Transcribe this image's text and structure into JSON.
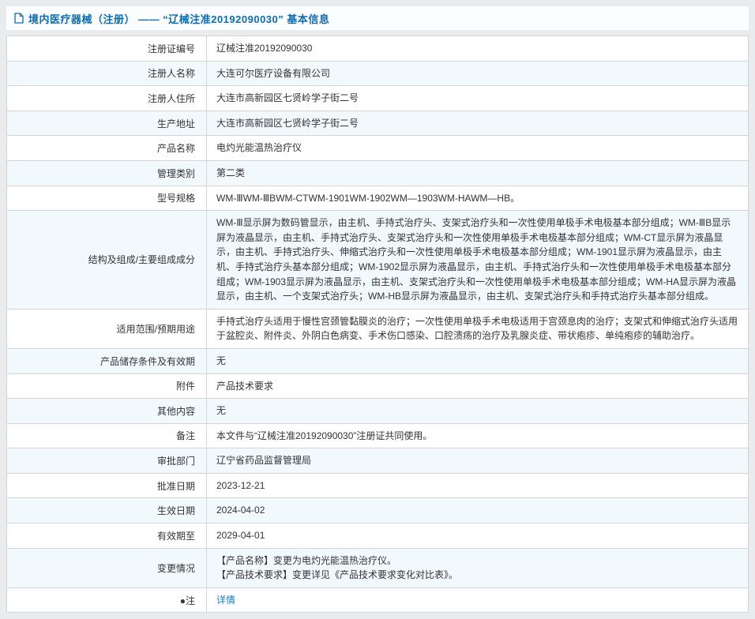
{
  "header": {
    "title": "境内医疗器械（注册） —— “辽械注准20192090030” 基本信息",
    "icon": "document-icon",
    "accent_color": "#0b6cb4"
  },
  "colors": {
    "page_background": "#e9ebed",
    "row_alt": "#f2f9fd",
    "border": "#d4d4d4",
    "link": "#1a7dc5"
  },
  "table": {
    "rows": [
      {
        "label": "注册证编号",
        "value": "辽械注准20192090030"
      },
      {
        "label": "注册人名称",
        "value": "大连可尔医疗设备有限公司"
      },
      {
        "label": "注册人住所",
        "value": "大连市高新园区七贤岭学子街二号"
      },
      {
        "label": "生产地址",
        "value": "大连市高新园区七贤岭学子街二号"
      },
      {
        "label": "产品名称",
        "value": "电灼光能温热治疗仪"
      },
      {
        "label": "管理类别",
        "value": "第二类"
      },
      {
        "label": "型号规格",
        "value": "WM-ⅢWM-ⅢBWM-CTWM-1901WM-1902WM—1903WM-HAWM—HB。"
      },
      {
        "label": "结构及组成/主要组成成分",
        "value": "WM-Ⅲ显示屏为数码管显示，由主机、手持式治疗头、支架式治疗头和一次性使用单极手术电极基本部分组成；WM-ⅢB显示屏为液晶显示，由主机、手持式治疗头、支架式治疗头和一次性使用单极手术电极基本部分组成；WM-CT显示屏为液晶显示，由主机、手持式治疗头、伸缩式治疗头和一次性使用单极手术电极基本部分组成；WM-1901显示屏为液晶显示，由主机、手持式治疗头基本部分组成；WM-1902显示屏为液晶显示，由主机、手持式治疗头和一次性使用单极手术电极基本部分组成；WM-1903显示屏为液晶显示，由主机、支架式治疗头和一次性使用单极手术电极基本部分组成；WM-HA显示屏为液晶显示，由主机、一个支架式治疗头；WM-HB显示屏为液晶显示，由主机、支架式治疗头和手持式治疗头基本部分组成。"
      },
      {
        "label": "适用范围/预期用途",
        "value": "手持式治疗头适用于慢性宫颈管黏膜炎的治疗；一次性使用单极手术电极适用于宫颈息肉的治疗；支架式和伸缩式治疗头适用于盆腔炎、附件炎、外阴白色病变、手术伤口感染、口腔溃疡的治疗及乳腺炎症、带状疱疹、单纯疱疹的辅助治疗。"
      },
      {
        "label": "产品储存条件及有效期",
        "value": "无"
      },
      {
        "label": "附件",
        "value": "产品技术要求"
      },
      {
        "label": "其他内容",
        "value": "无"
      },
      {
        "label": "备注",
        "value": "本文件与“辽械注准20192090030”注册证共同使用。"
      },
      {
        "label": "审批部门",
        "value": "辽宁省药品监督管理局"
      },
      {
        "label": "批准日期",
        "value": "2023-12-21"
      },
      {
        "label": "生效日期",
        "value": "2024-04-02"
      },
      {
        "label": "有效期至",
        "value": "2029-04-01"
      },
      {
        "label": "变更情况",
        "value": "【产品名称】变更为电灼光能温热治疗仪。\n【产品技术要求】变更详见《产品技术要求变化对比表》。"
      },
      {
        "label": "●注",
        "value": "详情"
      }
    ]
  }
}
